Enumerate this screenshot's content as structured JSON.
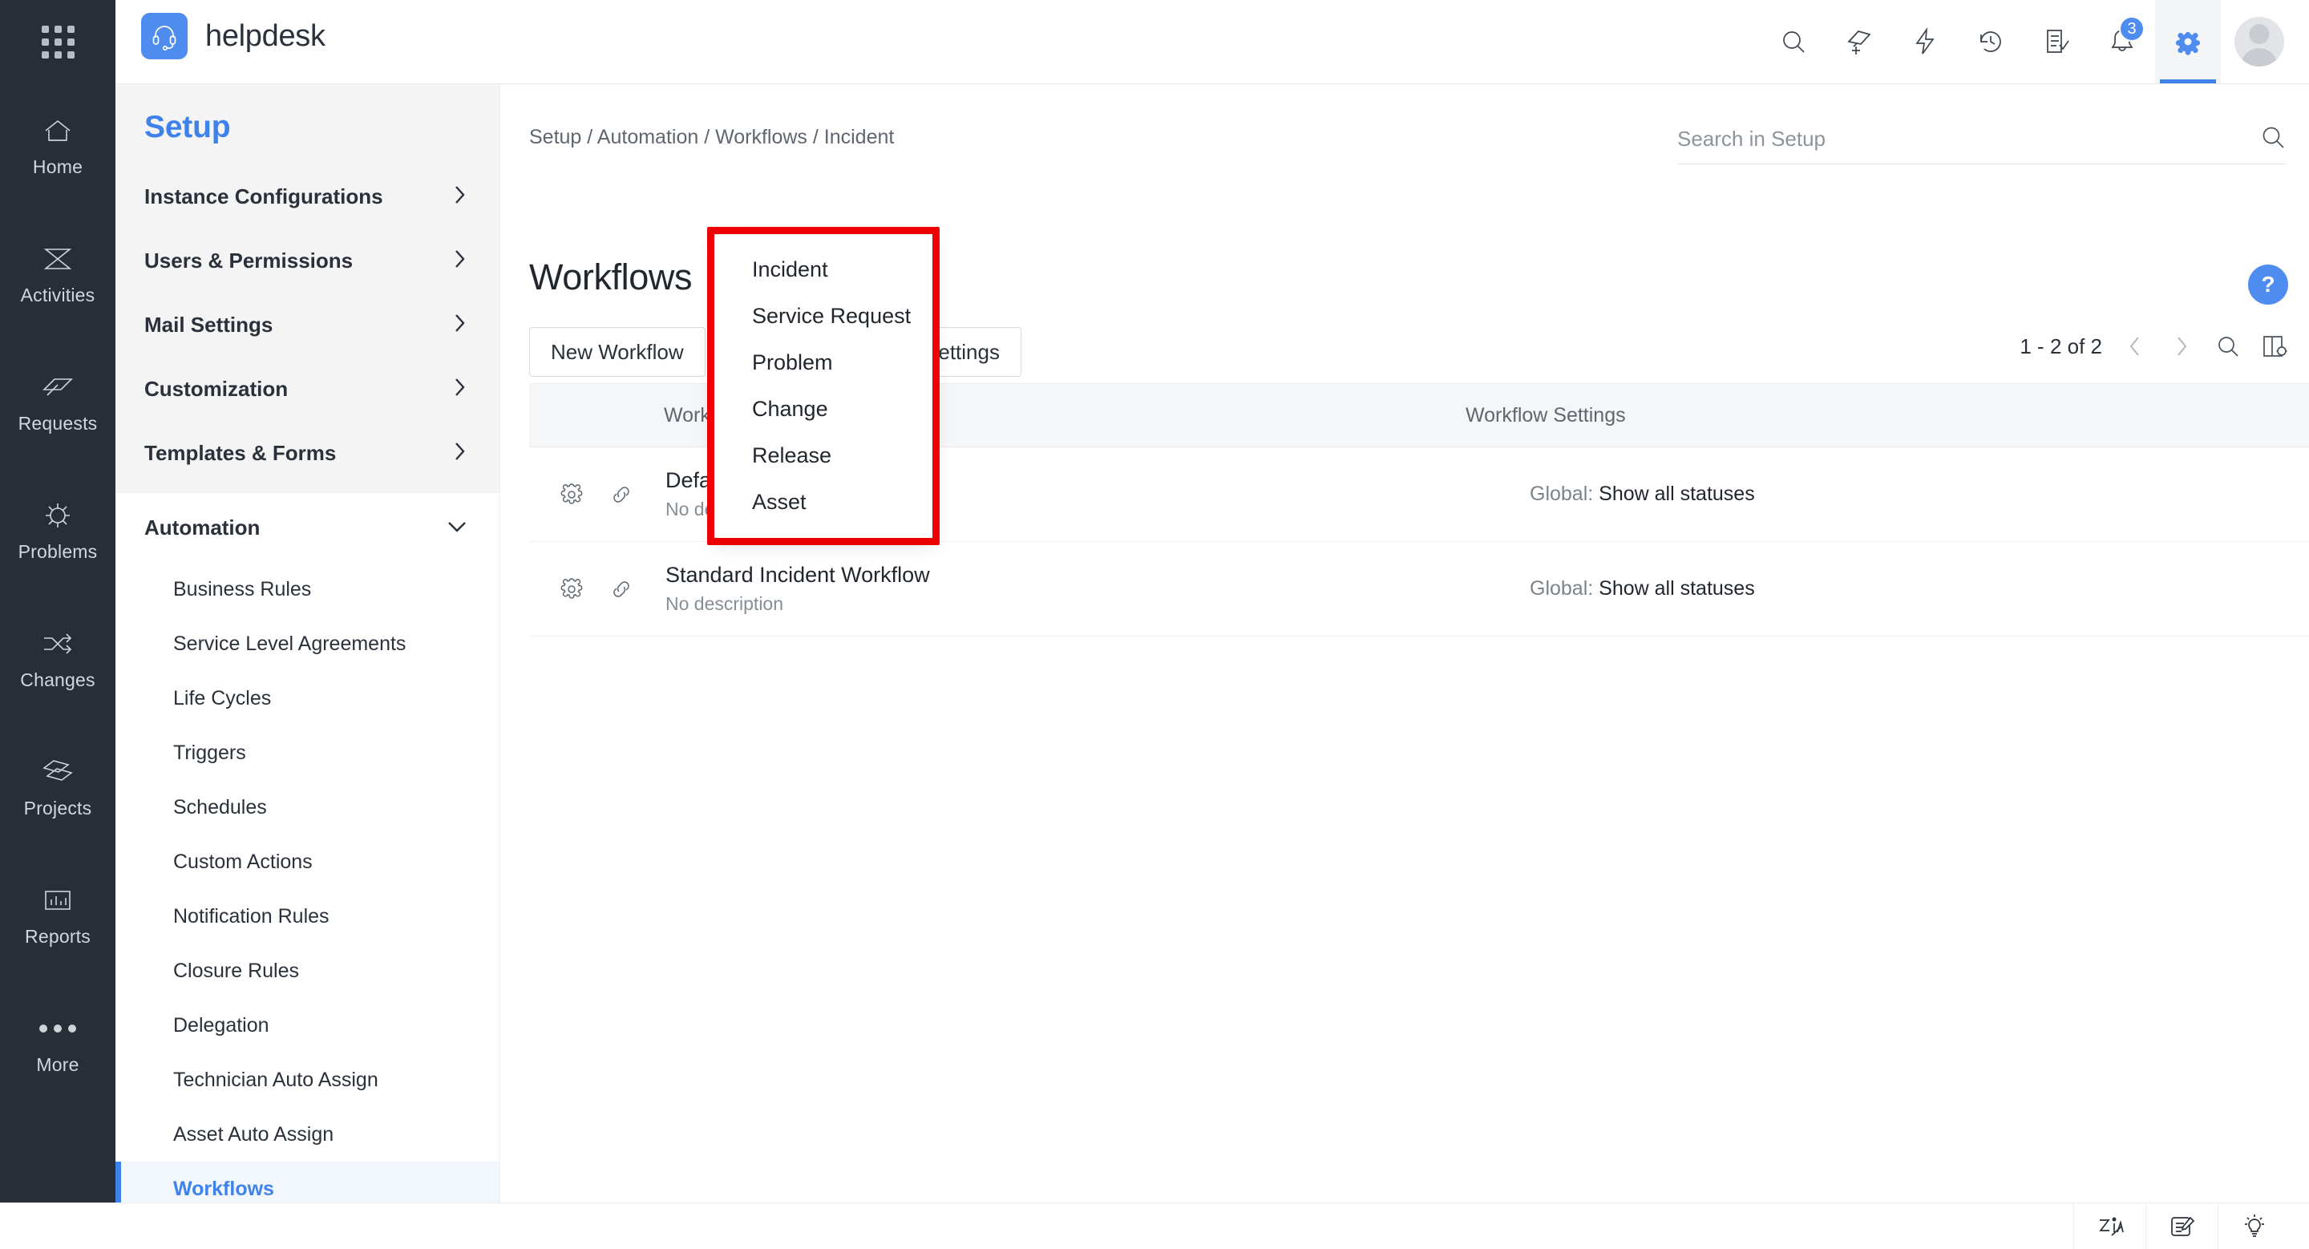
{
  "app": {
    "name": "helpdesk",
    "logo_icon": "headset-icon",
    "apps_grid_icon": "apps-grid-icon"
  },
  "topbar": {
    "icons": [
      {
        "name": "search-icon",
        "label": "Search"
      },
      {
        "name": "add-request-icon",
        "label": "Add"
      },
      {
        "name": "quick-actions-icon",
        "label": "Quick Actions"
      },
      {
        "name": "history-icon",
        "label": "Recent Items"
      },
      {
        "name": "tasks-icon",
        "label": "Tasks"
      },
      {
        "name": "notifications-icon",
        "label": "Notifications"
      },
      {
        "name": "setup-gear-icon",
        "label": "Setup"
      }
    ],
    "notification_badge": "3",
    "avatar_name": "user-avatar",
    "accent_color": "#4e8cf0"
  },
  "rail": {
    "items": [
      {
        "label": "Home",
        "icon": "home-icon"
      },
      {
        "label": "Activities",
        "icon": "activities-icon"
      },
      {
        "label": "Requests",
        "icon": "requests-icon"
      },
      {
        "label": "Problems",
        "icon": "problems-icon"
      },
      {
        "label": "Changes",
        "icon": "changes-icon"
      },
      {
        "label": "Projects",
        "icon": "projects-icon"
      },
      {
        "label": "Reports",
        "icon": "reports-icon"
      },
      {
        "label": "More",
        "icon": "more-dots-icon"
      }
    ]
  },
  "sidebar": {
    "title": "Setup",
    "groups": [
      {
        "label": "Instance Configurations",
        "expanded": false
      },
      {
        "label": "Users & Permissions",
        "expanded": false
      },
      {
        "label": "Mail Settings",
        "expanded": false
      },
      {
        "label": "Customization",
        "expanded": false
      },
      {
        "label": "Templates & Forms",
        "expanded": false
      }
    ],
    "automation": {
      "label": "Automation",
      "expanded": true
    },
    "automation_items": [
      {
        "label": "Business Rules",
        "selected": false
      },
      {
        "label": "Service Level Agreements",
        "selected": false
      },
      {
        "label": "Life Cycles",
        "selected": false
      },
      {
        "label": "Triggers",
        "selected": false
      },
      {
        "label": "Schedules",
        "selected": false
      },
      {
        "label": "Custom Actions",
        "selected": false
      },
      {
        "label": "Notification Rules",
        "selected": false
      },
      {
        "label": "Closure Rules",
        "selected": false
      },
      {
        "label": "Delegation",
        "selected": false
      },
      {
        "label": "Technician Auto Assign",
        "selected": false
      },
      {
        "label": "Asset Auto Assign",
        "selected": false
      },
      {
        "label": "Workflows",
        "selected": true
      }
    ]
  },
  "main": {
    "breadcrumb": "Setup / Automation / Workflows / Incident",
    "page_title": "Workflows",
    "module_selected": "Incident",
    "help_label": "?",
    "search": {
      "placeholder": "Search in Setup",
      "value": ""
    },
    "toolbar": {
      "new_workflow_label": "New Workflow",
      "global_settings_label": "Global Workflow Settings"
    },
    "pagination": {
      "count_label": "1 - 2 of 2",
      "prev_icon": "chevron-left-icon",
      "next_icon": "chevron-right-icon",
      "search_icon": "search-icon",
      "columns_icon": "column-settings-icon"
    },
    "table": {
      "headers": {
        "name": "Workflow Name",
        "settings": "Workflow Settings"
      },
      "rows": [
        {
          "name": "Default Incident Workflow",
          "description": "No description",
          "settings_prefix": "Global:",
          "settings_value": "Show all statuses",
          "gear_icon": "gear-icon",
          "link_icon": "link-icon"
        },
        {
          "name": "Standard Incident Workflow",
          "description": "No description",
          "settings_prefix": "Global:",
          "settings_value": "Show all statuses",
          "gear_icon": "gear-icon",
          "link_icon": "link-icon"
        }
      ]
    },
    "module_dropdown": {
      "highlighted": true,
      "highlight_color": "#ee0000",
      "options": [
        "Incident",
        "Service Request",
        "Problem",
        "Change",
        "Release",
        "Asset"
      ]
    }
  },
  "footer": {
    "icons": [
      {
        "name": "zia-icon",
        "label": "Zia"
      },
      {
        "name": "notes-edit-icon",
        "label": "Notes"
      },
      {
        "name": "lightbulb-icon",
        "label": "Tips"
      }
    ]
  }
}
